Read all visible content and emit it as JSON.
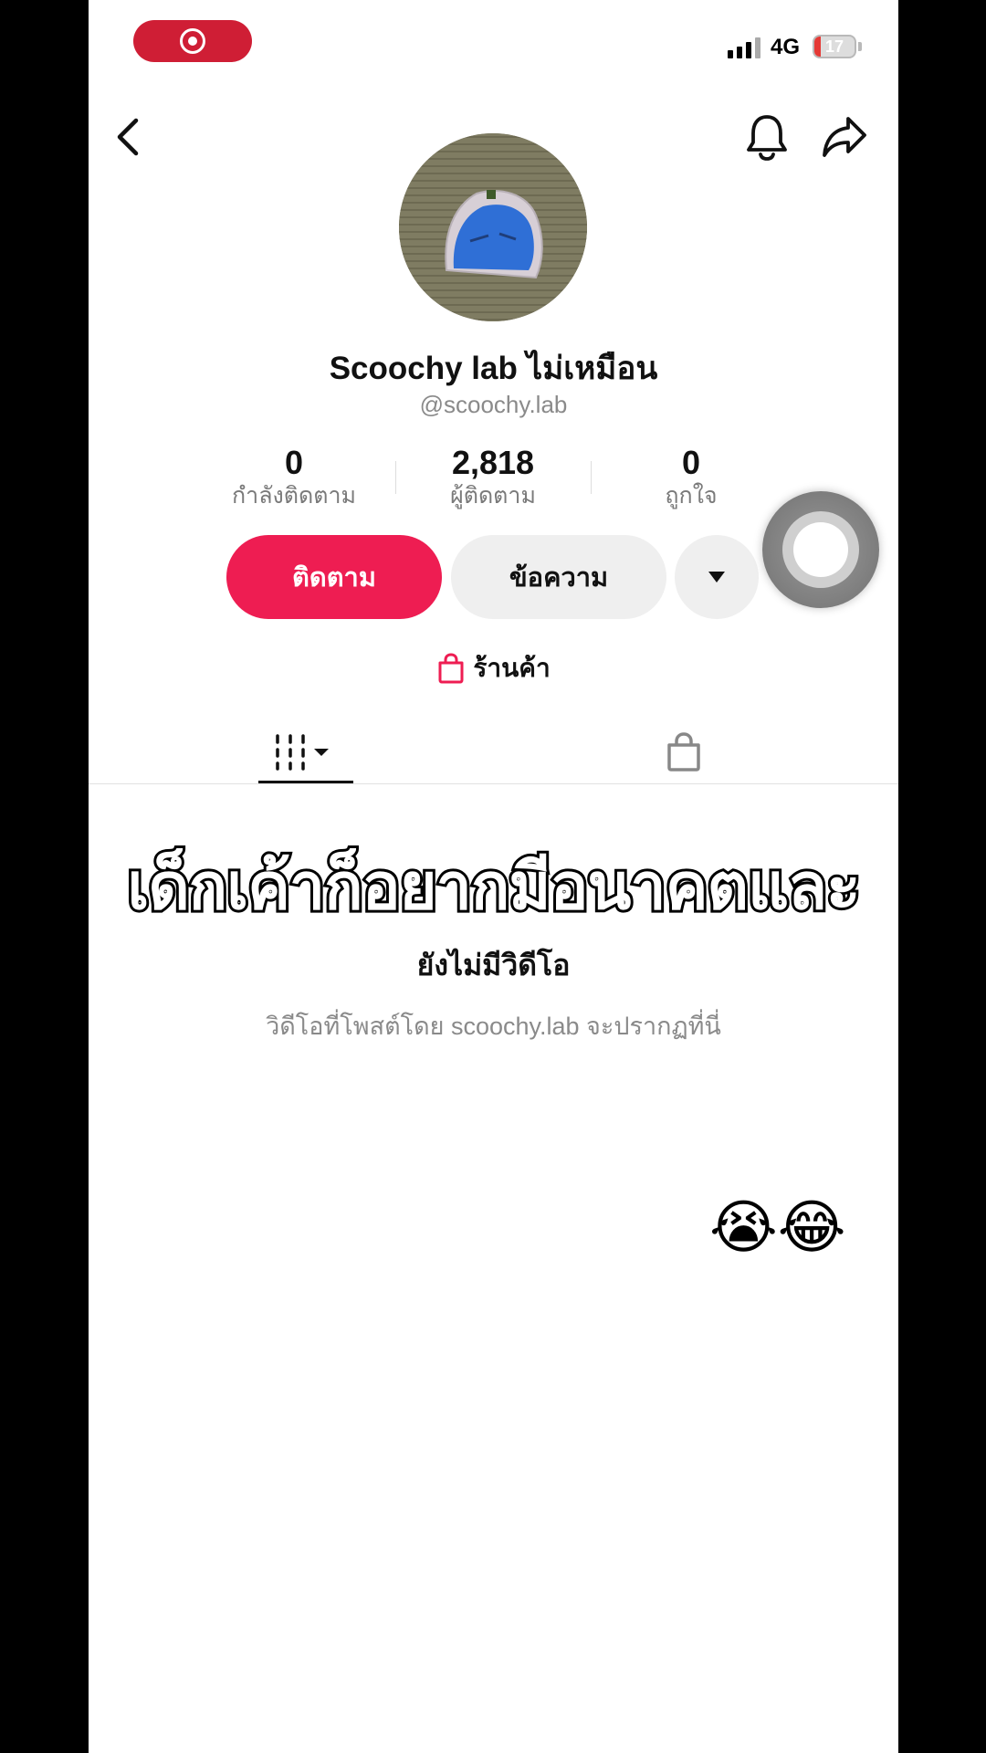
{
  "status_bar": {
    "network": "4G",
    "battery": "17",
    "battery_level": 0.17
  },
  "header": {
    "back_icon": "chevron-left-icon",
    "bell_icon": "bell-icon",
    "share_icon": "share-arrow-icon"
  },
  "profile": {
    "display_name": "Scoochy lab ไม่เหมือน",
    "username": "@scoochy.lab"
  },
  "stats": [
    {
      "value": "0",
      "label": "กำลังติดตาม"
    },
    {
      "value": "2,818",
      "label": "ผู้ติดตาม"
    },
    {
      "value": "0",
      "label": "ถูกใจ"
    }
  ],
  "actions": {
    "follow_label": "ติดตาม",
    "message_label": "ข้อความ",
    "more_icon": "caret-down-icon"
  },
  "shop": {
    "label": "ร้านค้า",
    "icon": "shopping-bag-icon"
  },
  "tabs": {
    "videos_icon": "grid-icon",
    "shop_icon": "shopping-bag-icon"
  },
  "overlay_text": "เด็กเค้าก็อยากมีอนาคตและ",
  "empty_state": {
    "title": "ยังไม่มีวิดีโอ",
    "subtitle": "วิดีโอที่โพสต์โดย scoochy.lab จะปรากฏที่นี่"
  },
  "emoji_text": "😭😂",
  "colors": {
    "accent": "#ee1d52",
    "record": "#cf1e35"
  }
}
